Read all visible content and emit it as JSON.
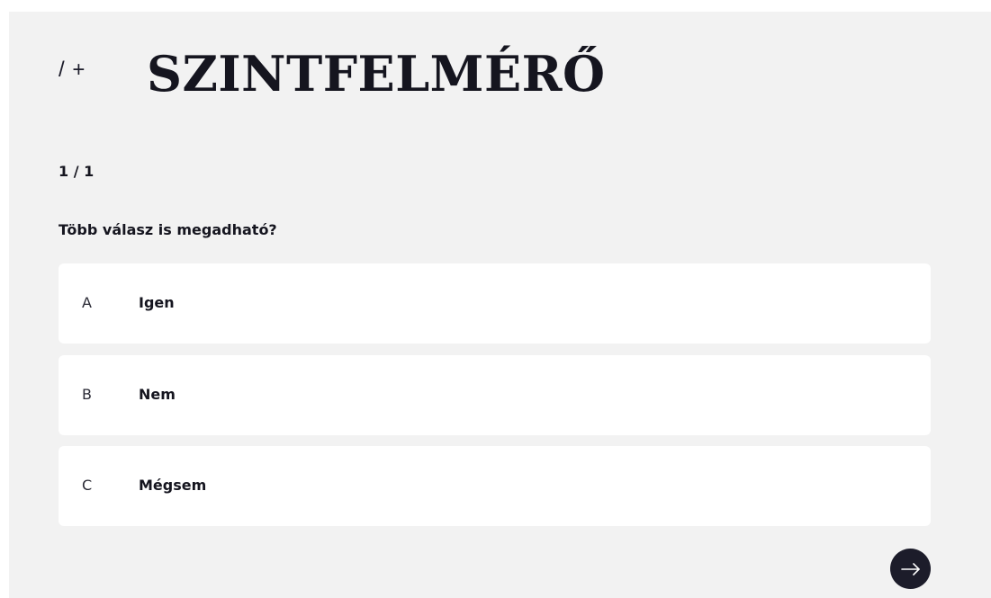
{
  "header": {
    "brand_mark": "/ +",
    "title": "SZINTFELMÉRŐ"
  },
  "quiz": {
    "progress": "1 / 1",
    "question": "Több válasz is megadható?",
    "options": [
      {
        "letter": "A",
        "label": "Igen"
      },
      {
        "letter": "B",
        "label": "Nem"
      },
      {
        "letter": "C",
        "label": "Mégsem"
      }
    ]
  },
  "next_button": {
    "icon": "arrow-right-icon"
  },
  "colors": {
    "panel_background": "#f2f2f2",
    "option_background": "#ffffff",
    "text": "#15151f",
    "next_button": "#1c1c2a"
  }
}
